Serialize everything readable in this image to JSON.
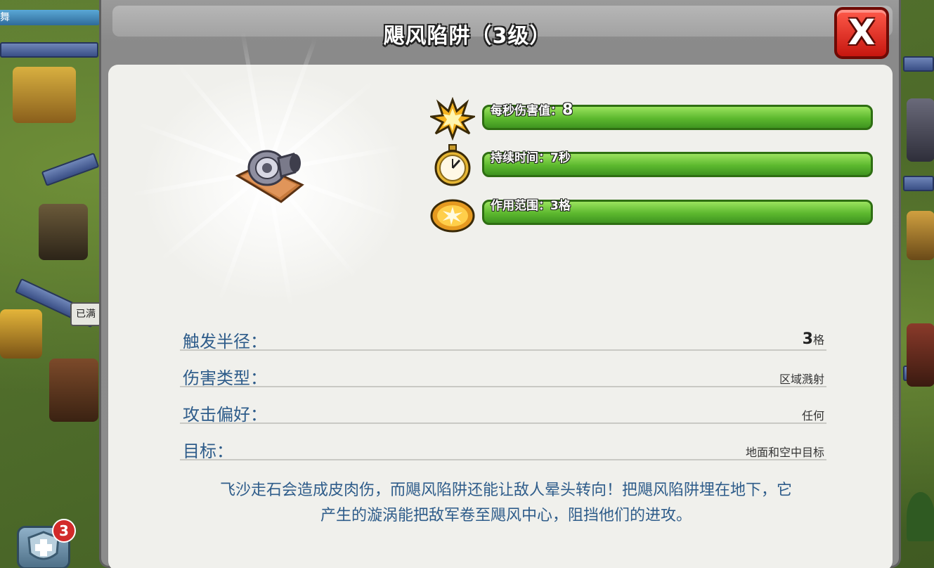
{
  "background": {
    "top_left_name": "舞",
    "side_button": "已满",
    "notification_count": "3"
  },
  "modal": {
    "title": "飓风陷阱（3级）",
    "close_label": "X",
    "stats": [
      {
        "label": "每秒伤害值：",
        "value": "8",
        "icon": "explosion-icon",
        "fill": 1.0
      },
      {
        "label": "持续时间：",
        "value": "7秒",
        "icon": "stopwatch-icon",
        "fill": 1.0
      },
      {
        "label": "作用范围：",
        "value": "3格",
        "icon": "area-blast-icon",
        "fill": 1.0
      }
    ],
    "info_rows": [
      {
        "label": "触发半径：",
        "value_num": "3",
        "value_unit": "格"
      },
      {
        "label": "伤害类型：",
        "value": "区域溅射"
      },
      {
        "label": "攻击偏好：",
        "value": "任何"
      },
      {
        "label": "目标：",
        "value": "地面和空中目标"
      }
    ],
    "description_line1": "飞沙走石会造成皮肉伤，而飓风陷阱还能让敌人晕头转向！把飓风陷阱埋在地下，它",
    "description_line2": "产生的漩涡能把敌军卷至飓风中心，阻挡他们的进攻。"
  },
  "colors": {
    "bar_green": "#5cb82e",
    "close_red": "#d8261a",
    "label_blue": "#2e5c8a"
  }
}
